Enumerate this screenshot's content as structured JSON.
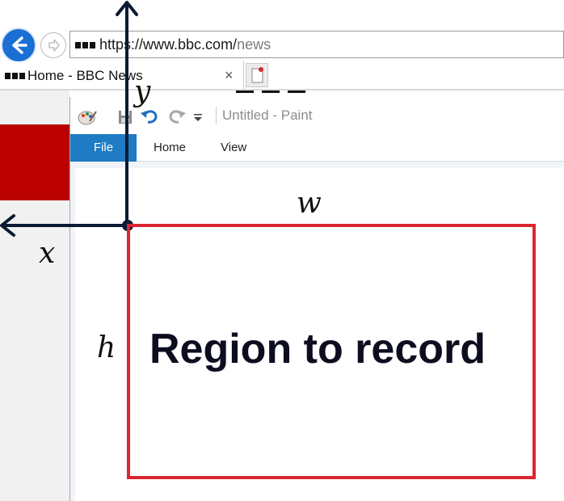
{
  "browser": {
    "url_host": "https://www.bbc.com/",
    "url_path": "news",
    "tab_title": "Home - BBC News",
    "tab_close": "×",
    "icons": [
      "back-arrow-icon",
      "forward-arrow-icon",
      "site-badge-icon",
      "close-icon",
      "new-tab-icon"
    ],
    "back_button_color": "#1a6fd4"
  },
  "page": {
    "banner_color": "#bb0000"
  },
  "paint": {
    "window_title": "Untitled - Paint",
    "quick_access_icons": [
      "palette-icon",
      "save-icon",
      "undo-icon",
      "redo-icon",
      "customize-dropdown-icon"
    ],
    "ribbon_tabs": [
      {
        "label": "File",
        "active": true
      },
      {
        "label": "Home",
        "active": false
      },
      {
        "label": "View",
        "active": false
      }
    ],
    "file_tab_color": "#1e7bc4"
  },
  "annotation": {
    "x_label": "x",
    "y_label": "y",
    "w_label": "w",
    "h_label": "h",
    "region_label": "Region to record",
    "region_color": "#db2533",
    "axis_color": "#0b1a33"
  }
}
